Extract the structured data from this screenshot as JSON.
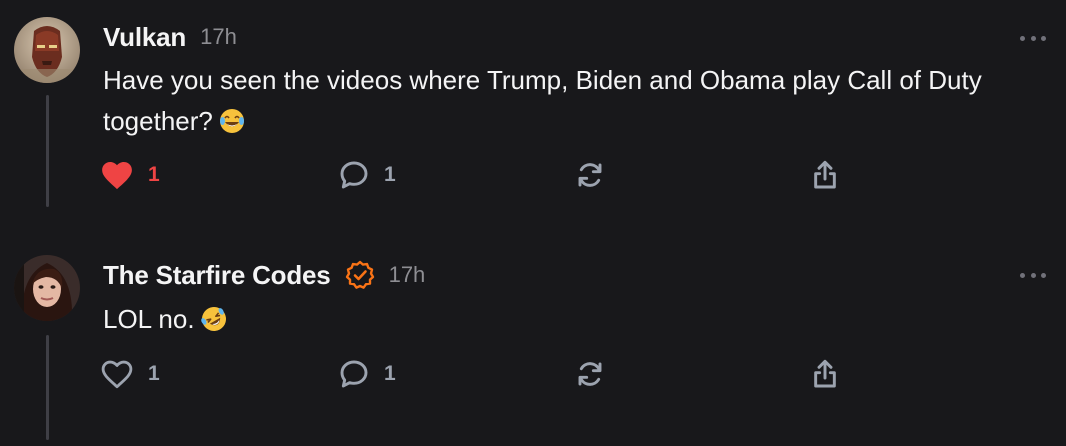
{
  "posts": [
    {
      "author": "Vulkan",
      "time": "17h",
      "text": "Have you seen the videos where Trump, Biden and Obama play Call of Duty together?",
      "emoji": "face-with-tears-of-joy",
      "liked": true,
      "like_count": "1",
      "reply_count": "1",
      "verified": false
    },
    {
      "author": "The Starfire Codes",
      "time": "17h",
      "text": "LOL no.",
      "emoji": "rolling-on-the-floor-laughing",
      "liked": false,
      "like_count": "1",
      "reply_count": "1",
      "verified": true
    }
  ],
  "colors": {
    "background": "#18181b",
    "text": "#f4f4f5",
    "muted": "#8e8e93",
    "like_active": "#ef4444",
    "verified_badge": "#f97316",
    "thread_line": "#3f3f46"
  }
}
